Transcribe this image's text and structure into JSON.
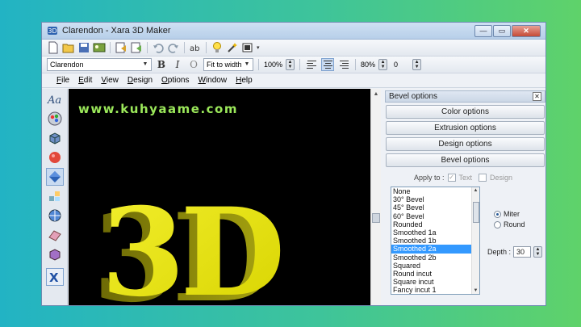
{
  "window": {
    "title": "Clarendon - Xara 3D Maker"
  },
  "titlebar_buttons": {
    "minimize": "—",
    "maximize": "▭",
    "close": "✕"
  },
  "toolbar2": {
    "font": "Clarendon",
    "fit": "Fit to width",
    "zoom": "100%",
    "bold": "B",
    "italic": "I",
    "outline": "O",
    "line_spacing": "80%",
    "letter_spacing": "0"
  },
  "menu": [
    "File",
    "Edit",
    "View",
    "Design",
    "Options",
    "Window",
    "Help"
  ],
  "canvas": {
    "watermark": "www.kuhyaame.com",
    "text": "3D"
  },
  "panel": {
    "title": "Bevel options",
    "buttons": [
      "Color options",
      "Extrusion options",
      "Design options",
      "Bevel options"
    ],
    "apply_label": "Apply to :",
    "apply_text": "Text",
    "apply_design": "Design",
    "bevel_items": [
      "None",
      "30° Bevel",
      "45° Bevel",
      "60° Bevel",
      "Rounded",
      "Smoothed 1a",
      "Smoothed 1b",
      "Smoothed 2a",
      "Smoothed 2b",
      "Squared",
      "Round incut",
      "Square incut",
      "Fancy incut 1"
    ],
    "selected_index": 7,
    "miter": "Miter",
    "round": "Round",
    "depth_label": "Depth :",
    "depth_value": "30"
  },
  "left_tools": [
    "text-tool-icon",
    "color-tool-icon",
    "extrude-tool-icon",
    "shade-tool-icon",
    "bevel-tool-icon",
    "lighting-tool-icon",
    "rotate-tool-icon",
    "animation-tool-icon",
    "frame-tool-icon",
    "xara-icon"
  ],
  "colors": {
    "accent": "#3399ff",
    "text_3d": "#e5e016",
    "watermark": "#9be85a"
  }
}
